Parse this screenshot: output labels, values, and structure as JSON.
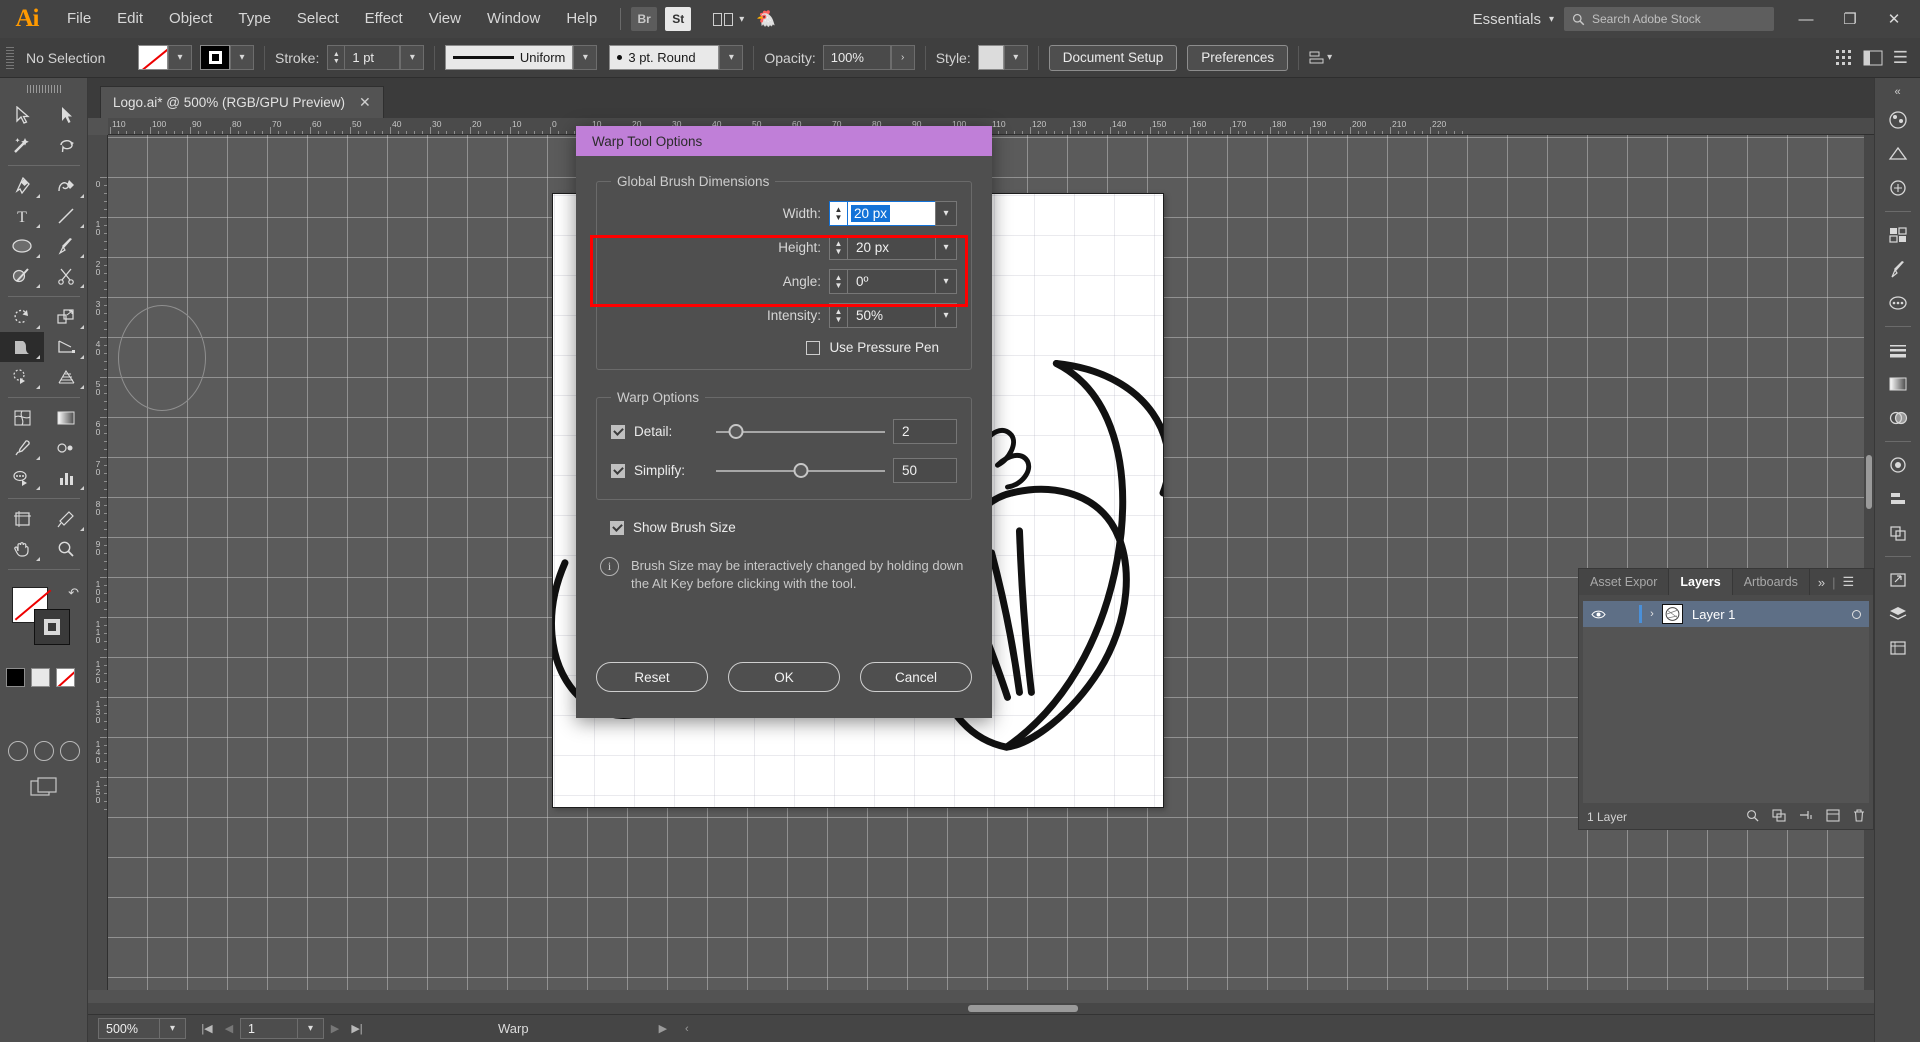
{
  "app": {
    "name": "Ai",
    "menus": [
      "File",
      "Edit",
      "Object",
      "Type",
      "Select",
      "Effect",
      "View",
      "Window",
      "Help"
    ],
    "bridge_button": "Br",
    "stock_button": "St",
    "workspace": "Essentials",
    "search_placeholder": "Search Adobe Stock",
    "window_controls": {
      "minimize": "—",
      "maximize": "❐",
      "close": "✕"
    }
  },
  "control_bar": {
    "selection_status": "No Selection",
    "fill_label": "fill-none",
    "stroke_swatch_label": "stroke-black",
    "stroke_label": "Stroke:",
    "stroke_weight": "1 pt",
    "profile": "Uniform",
    "brush": "3 pt. Round",
    "opacity_label": "Opacity:",
    "opacity_value": "100%",
    "style_label": "Style:",
    "document_setup": "Document Setup",
    "preferences": "Preferences"
  },
  "document_tab": {
    "title": "Logo.ai* @ 500% (RGB/GPU Preview)",
    "close": "✕"
  },
  "rulers": {
    "horizontal": [
      "110",
      "100",
      "90",
      "80",
      "70",
      "60",
      "50",
      "40",
      "30",
      "20",
      "10",
      "0",
      "10",
      "20",
      "30",
      "40",
      "50",
      "60",
      "70",
      "80",
      "90",
      "100",
      "110",
      "120",
      "130",
      "140",
      "150",
      "160",
      "170",
      "180",
      "190",
      "200",
      "210",
      "220"
    ],
    "vertical": [
      "0",
      "10",
      "20",
      "30",
      "40",
      "50",
      "60",
      "70",
      "80",
      "90",
      "100",
      "110",
      "120",
      "130",
      "140",
      "150"
    ]
  },
  "dialog": {
    "title": "Warp Tool Options",
    "global_brush": {
      "legend": "Global Brush Dimensions",
      "fields": [
        {
          "label": "Width:",
          "value": "20 px",
          "editing": true
        },
        {
          "label": "Height:",
          "value": "20 px",
          "editing": false
        },
        {
          "label": "Angle:",
          "value": "0º",
          "editing": false
        },
        {
          "label": "Intensity:",
          "value": "50%",
          "editing": false
        }
      ],
      "use_pressure_pen": {
        "label": "Use Pressure Pen",
        "checked": false
      }
    },
    "warp_options": {
      "legend": "Warp Options",
      "detail": {
        "label": "Detail:",
        "checked": true,
        "value": "2",
        "percent": 12
      },
      "simplify": {
        "label": "Simplify:",
        "checked": true,
        "value": "50",
        "percent": 50
      }
    },
    "show_brush_size": {
      "label": "Show Brush Size",
      "checked": true
    },
    "info_icon": "i",
    "info_text": "Brush Size may be interactively changed by holding down the Alt Key before clicking with the tool.",
    "buttons": {
      "reset": "Reset",
      "ok": "OK",
      "cancel": "Cancel"
    },
    "highlight_color": "#ff0000",
    "titlebar_color": "#c07fd8"
  },
  "layers_panel": {
    "tabs": [
      {
        "label": "Asset Expor",
        "selected": false
      },
      {
        "label": "Layers",
        "selected": true
      },
      {
        "label": "Artboards",
        "selected": false
      }
    ],
    "overflow": "»",
    "menu_icon": "☰",
    "rows": [
      {
        "name": "Layer 1",
        "visible": true,
        "expand": "›"
      }
    ],
    "footer_count": "1 Layer",
    "footer_icons": [
      "search-icon",
      "new-sublayer-icon",
      "locate-icon",
      "new-layer-icon",
      "delete-icon"
    ]
  },
  "status_bar": {
    "zoom": "500%",
    "page": "1",
    "tool": "Warp",
    "first": "|◀",
    "prev": "◀",
    "next": "▶",
    "last": "▶|",
    "play": "▶",
    "back": "‹"
  },
  "tools": [
    "selection-tool",
    "direct-selection-tool",
    "magic-wand-tool",
    "lasso-tool",
    "pen-tool",
    "curvature-tool",
    "type-tool",
    "line-segment-tool",
    "ellipse-tool",
    "paintbrush-tool",
    "shaper-tool",
    "scissors-tool",
    "rotate-tool",
    "scale-tool",
    "width-warp-tool",
    "free-transform-tool",
    "shape-builder-tool",
    "perspective-grid-tool",
    "mesh-tool",
    "gradient-tool",
    "eyedropper-tool",
    "blend-tool",
    "symbol-sprayer-tool",
    "column-graph-tool",
    "artboard-tool",
    "slice-tool",
    "hand-tool",
    "zoom-tool"
  ],
  "dock_icons": [
    "color-panel-icon",
    "color-guide-icon",
    "properties-icon",
    "libraries-icon",
    "brushes-icon",
    "symbols-icon",
    "stroke-panel-icon",
    "gradient-panel-icon",
    "transparency-icon",
    "appearance-icon",
    "align-icon",
    "pathfinder-icon",
    "transform-icon",
    "export-icon",
    "layers-icon",
    "artboards-icon"
  ]
}
